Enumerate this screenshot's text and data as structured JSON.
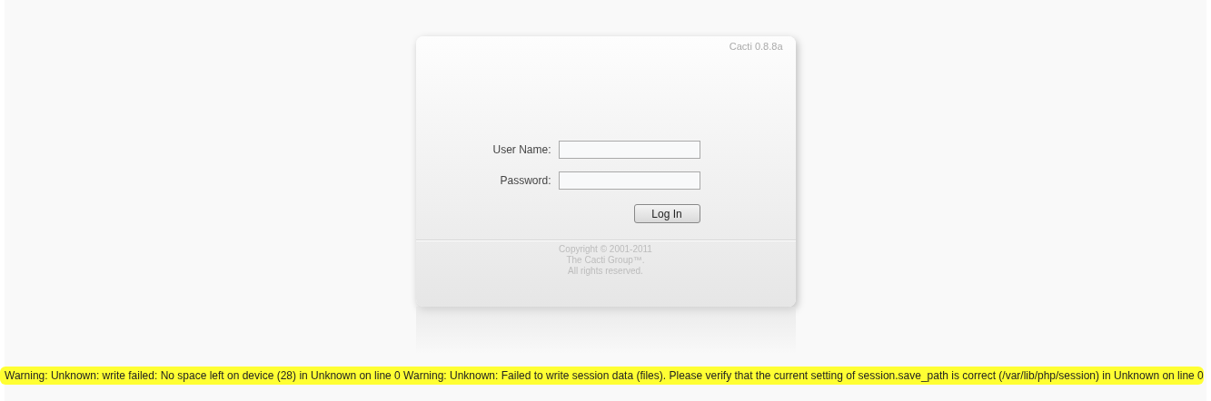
{
  "login_panel": {
    "version": "Cacti 0.8.8a",
    "fields": [
      {
        "label": "User Name:"
      },
      {
        "label": "Password:"
      }
    ],
    "submit_button": "Log In",
    "footer_lines": [
      "Copyright © 2001-2011",
      "The Cacti Group™.",
      "All rights reserved."
    ]
  },
  "warning": "Warning: Unknown: write failed: No space left on device (28) in Unknown on line 0 Warning: Unknown: Failed to write session data (files). Please verify that the current setting of session.save_path is correct (/var/lib/php/session) in Unknown on line 0"
}
